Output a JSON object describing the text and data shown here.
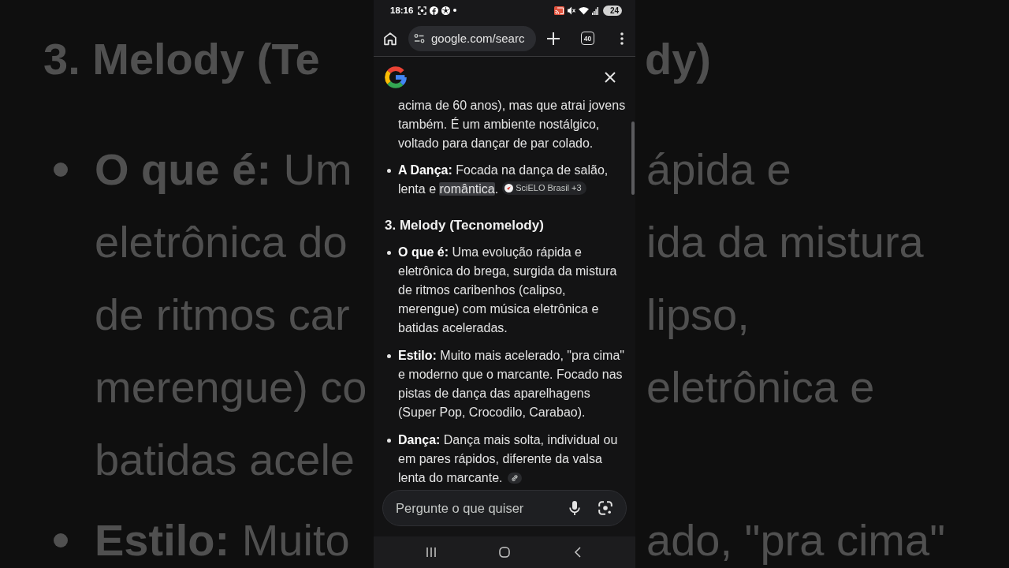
{
  "background": {
    "left": [
      {
        "kind": "heading",
        "text": "3. Melody (Te"
      },
      {
        "kind": "bullet",
        "lines": [
          "**O que é:** Um",
          "eletrônica do",
          "de ritmos car",
          "merengue) co",
          "batidas acele"
        ]
      },
      {
        "kind": "bullet",
        "lines": [
          "**Estilo:** Muito"
        ]
      }
    ],
    "right": [
      {
        "kind": "heading",
        "text": "dy)"
      },
      {
        "kind": "continued",
        "lines": [
          "ápida e",
          "ida da mistura",
          "lipso,",
          "eletrônica e"
        ]
      },
      {
        "kind": "continued",
        "lines": [
          "ado, \"pra cima\""
        ]
      }
    ]
  },
  "status_bar": {
    "time": "18:16",
    "battery": "24"
  },
  "toolbar": {
    "url": "google.com/searc",
    "tab_count": "40"
  },
  "overview": {
    "blocks": [
      {
        "kind": "paragraph",
        "parts": [
          {
            "text": "acima de 60 anos), mas que atrai jovens\ntambém. É um ambiente nostálgico,\nvoltado para dançar de par colado.",
            "highlighted": false
          }
        ]
      },
      {
        "kind": "bullet",
        "parts": [
          {
            "text": "**A Dança:** Focada na dança de salão,\nlenta e ",
            "highlighted": false
          },
          {
            "text": "romântica",
            "highlighted": true
          },
          {
            "text": ".",
            "highlighted": false
          }
        ],
        "source": {
          "kind": "chip",
          "label": "SciELO Brasil +3"
        }
      },
      {
        "kind": "heading",
        "text": "3. Melody (Tecnomelody)"
      },
      {
        "kind": "bullet",
        "parts": [
          {
            "text": "**O que é:** Uma evolução rápida e\neletrônica do brega, surgida da mistura\nde ritmos caribenhos (calipso,\nmerengue) com música eletrônica e\nbatidas aceleradas.",
            "highlighted": false
          }
        ]
      },
      {
        "kind": "bullet",
        "parts": [
          {
            "text": "**Estilo:** Muito mais acelerado, \"pra cima\"\ne moderno que o marcante. Focado nas\npistas de dança das aparelhagens\n(Super Pop, Crocodilo, Carabao).",
            "highlighted": false
          }
        ]
      },
      {
        "kind": "bullet",
        "parts": [
          {
            "text": "**Dança:** Dança mais solta, individual ou\nem pares rápidos, diferente da valsa\nlenta do marcante.",
            "highlighted": false
          }
        ],
        "source": {
          "kind": "link"
        }
      }
    ]
  },
  "search": {
    "placeholder": "Pergunte o que quiser"
  }
}
